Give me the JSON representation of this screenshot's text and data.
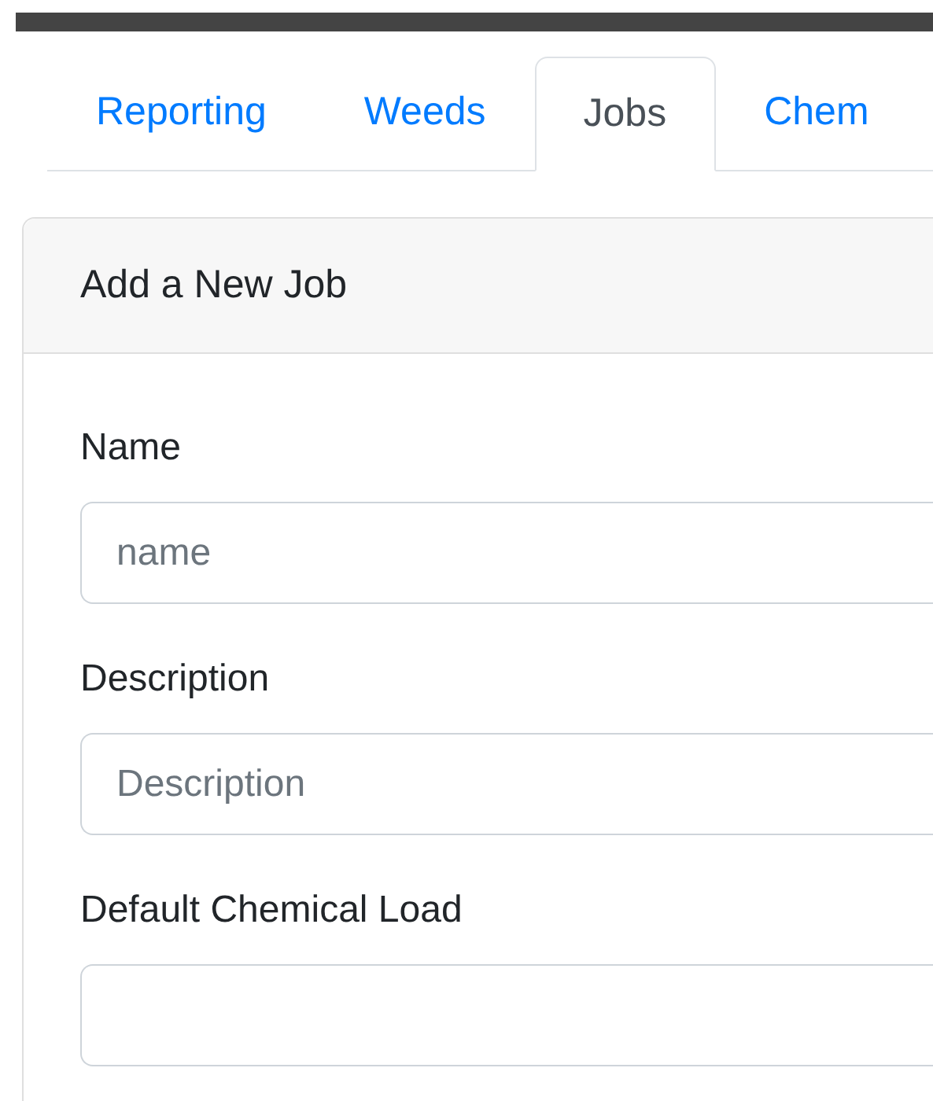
{
  "tabs": [
    {
      "label": "Reporting",
      "selected": false
    },
    {
      "label": "Weeds",
      "selected": false
    },
    {
      "label": "Jobs",
      "selected": true
    },
    {
      "label": "Chem",
      "selected": false
    }
  ],
  "card": {
    "title": "Add a New Job",
    "fields": [
      {
        "label": "Name",
        "placeholder": "name"
      },
      {
        "label": "Description",
        "placeholder": "Description"
      },
      {
        "label": "Default Chemical Load"
      }
    ]
  }
}
